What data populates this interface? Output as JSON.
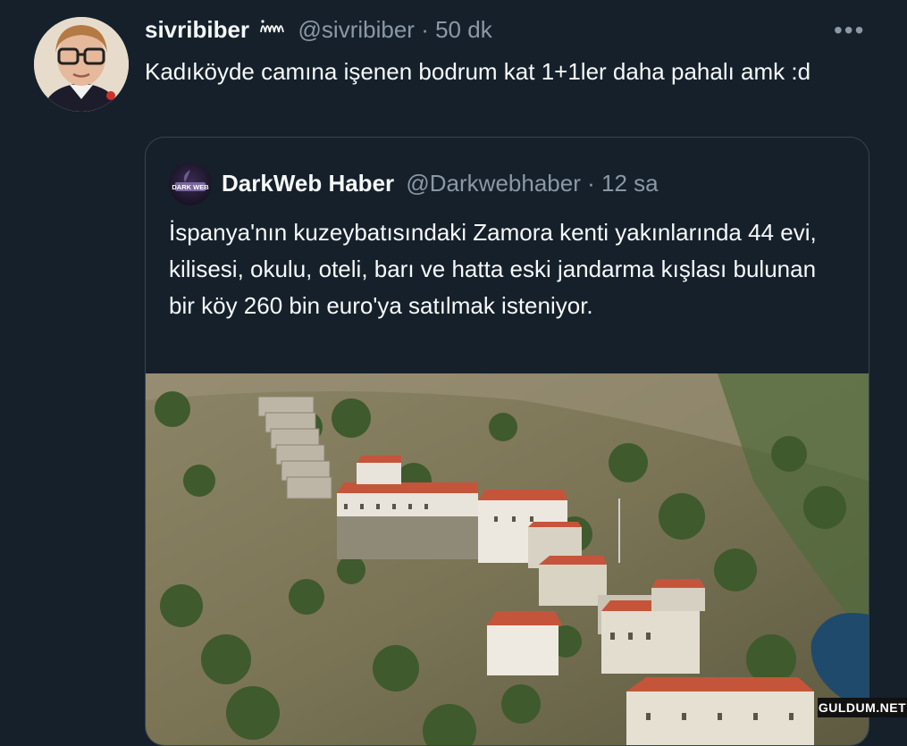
{
  "tweet": {
    "display_name": "sivribiber",
    "handle": "@sivribiber",
    "separator": "·",
    "time": "50 dk",
    "more": "•••",
    "text": "Kadıköyde camına işenen bodrum kat 1+1ler daha pahalı amk :d"
  },
  "quote": {
    "display_name": "DarkWeb Haber",
    "handle": "@Darkwebhaber",
    "separator": "·",
    "time": "12 sa",
    "avatar_text": "DARK WEB",
    "text": "İspanya'nın kuzeybatısındaki Zamora kenti yakınlarında 44 evi, kilisesi, okulu, oteli, barı ve hatta eski jandarma kışlası bulunan bir köy 260 bin euro'ya satılmak isteniyor."
  },
  "watermark": "GULDUM.NET",
  "colors": {
    "background": "#15202b",
    "text": "#f7f9f9",
    "secondary": "#8b98a5",
    "border": "#38444d",
    "roof": "#c4553a"
  },
  "icons": [
    "verified-squiggle-icon",
    "more-icon"
  ]
}
